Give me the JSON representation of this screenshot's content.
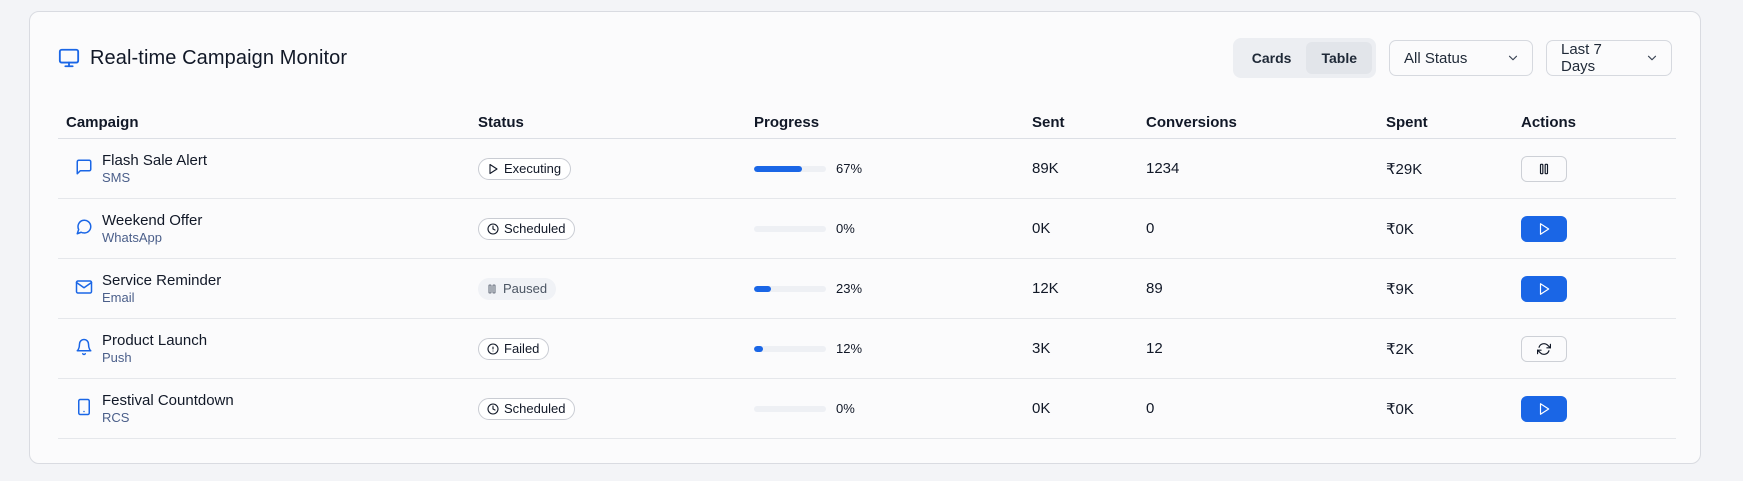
{
  "header": {
    "title": "Real-time Campaign Monitor",
    "view_toggle": [
      "Cards",
      "Table"
    ],
    "active_view": "Table",
    "status_filter": "All Status",
    "date_range": "Last 7 Days"
  },
  "table": {
    "columns": {
      "campaign": "Campaign",
      "status": "Status",
      "progress": "Progress",
      "sent": "Sent",
      "conversions": "Conversions",
      "spent": "Spent",
      "actions": "Actions"
    },
    "rows": [
      {
        "name": "Flash Sale Alert",
        "channel": "SMS",
        "channel_icon": "message-square-icon",
        "status": "Executing",
        "status_icon": "play-icon",
        "progress": 67,
        "progress_label": "67%",
        "sent": "89K",
        "conversions": "1234",
        "spent": "₹29K",
        "action": "pause"
      },
      {
        "name": "Weekend Offer",
        "channel": "WhatsApp",
        "channel_icon": "message-circle-icon",
        "status": "Scheduled",
        "status_icon": "clock-icon",
        "progress": 0,
        "progress_label": "0%",
        "sent": "0K",
        "conversions": "0",
        "spent": "₹0K",
        "action": "play"
      },
      {
        "name": "Service Reminder",
        "channel": "Email",
        "channel_icon": "mail-icon",
        "status": "Paused",
        "status_icon": "pause-icon",
        "progress": 23,
        "progress_label": "23%",
        "sent": "12K",
        "conversions": "89",
        "spent": "₹9K",
        "action": "play"
      },
      {
        "name": "Product Launch",
        "channel": "Push",
        "channel_icon": "bell-icon",
        "status": "Failed",
        "status_icon": "alert-circle-icon",
        "progress": 12,
        "progress_label": "12%",
        "sent": "3K",
        "conversions": "12",
        "spent": "₹2K",
        "action": "retry"
      },
      {
        "name": "Festival Countdown",
        "channel": "RCS",
        "channel_icon": "smartphone-icon",
        "status": "Scheduled",
        "status_icon": "clock-icon",
        "progress": 0,
        "progress_label": "0%",
        "sent": "0K",
        "conversions": "0",
        "spent": "₹0K",
        "action": "play"
      }
    ]
  },
  "colors": {
    "accent": "#1a66e6",
    "channel_label": "#4b5f8a"
  }
}
